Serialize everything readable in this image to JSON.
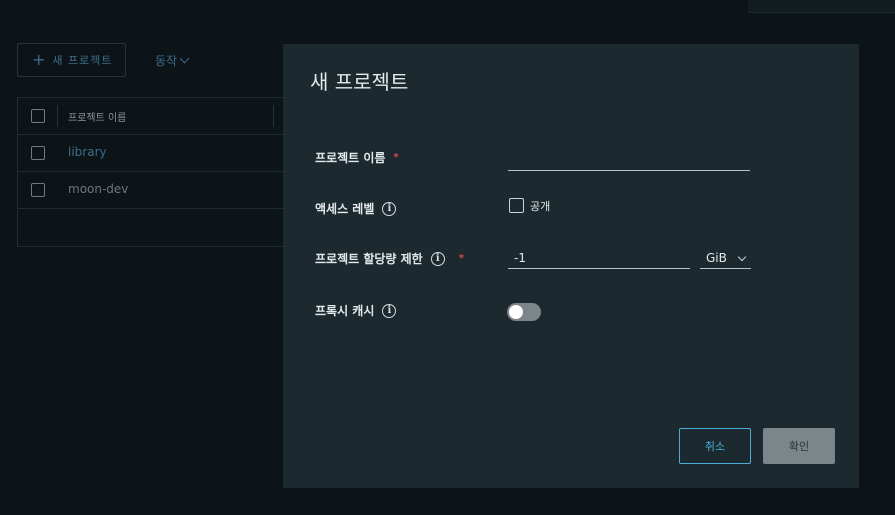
{
  "background": {
    "new_project_button": "새 프로젝트",
    "action_dropdown": "동작",
    "grid": {
      "column_header": "프로젝트 이름",
      "rows": [
        {
          "name": "library"
        },
        {
          "name": "moon-dev"
        }
      ]
    }
  },
  "dialog": {
    "title": "새 프로젝트",
    "fields": {
      "project_name_label": "프로젝트 이름",
      "project_name_value": "",
      "required_mark": "*",
      "access_level_label": "액세스 레벨",
      "public_label": "공개",
      "public_checked": false,
      "quota_label": "프로젝트 할당량 제한",
      "quota_value": "-1",
      "quota_unit": "GiB",
      "proxy_cache_label": "프록시 캐시",
      "proxy_cache_enabled": false
    },
    "info_icon_glyph": "i",
    "buttons": {
      "cancel": "취소",
      "confirm": "확인"
    }
  },
  "icons": {
    "plus": "plus-icon",
    "chevron": "chevron-down-icon",
    "info": "info-icon"
  },
  "colors": {
    "page_bg": "#0d1418",
    "dialog_bg": "#1c2a30",
    "accent": "#49afd9",
    "required": "#e0444d",
    "disabled_button": "#7c8589"
  }
}
